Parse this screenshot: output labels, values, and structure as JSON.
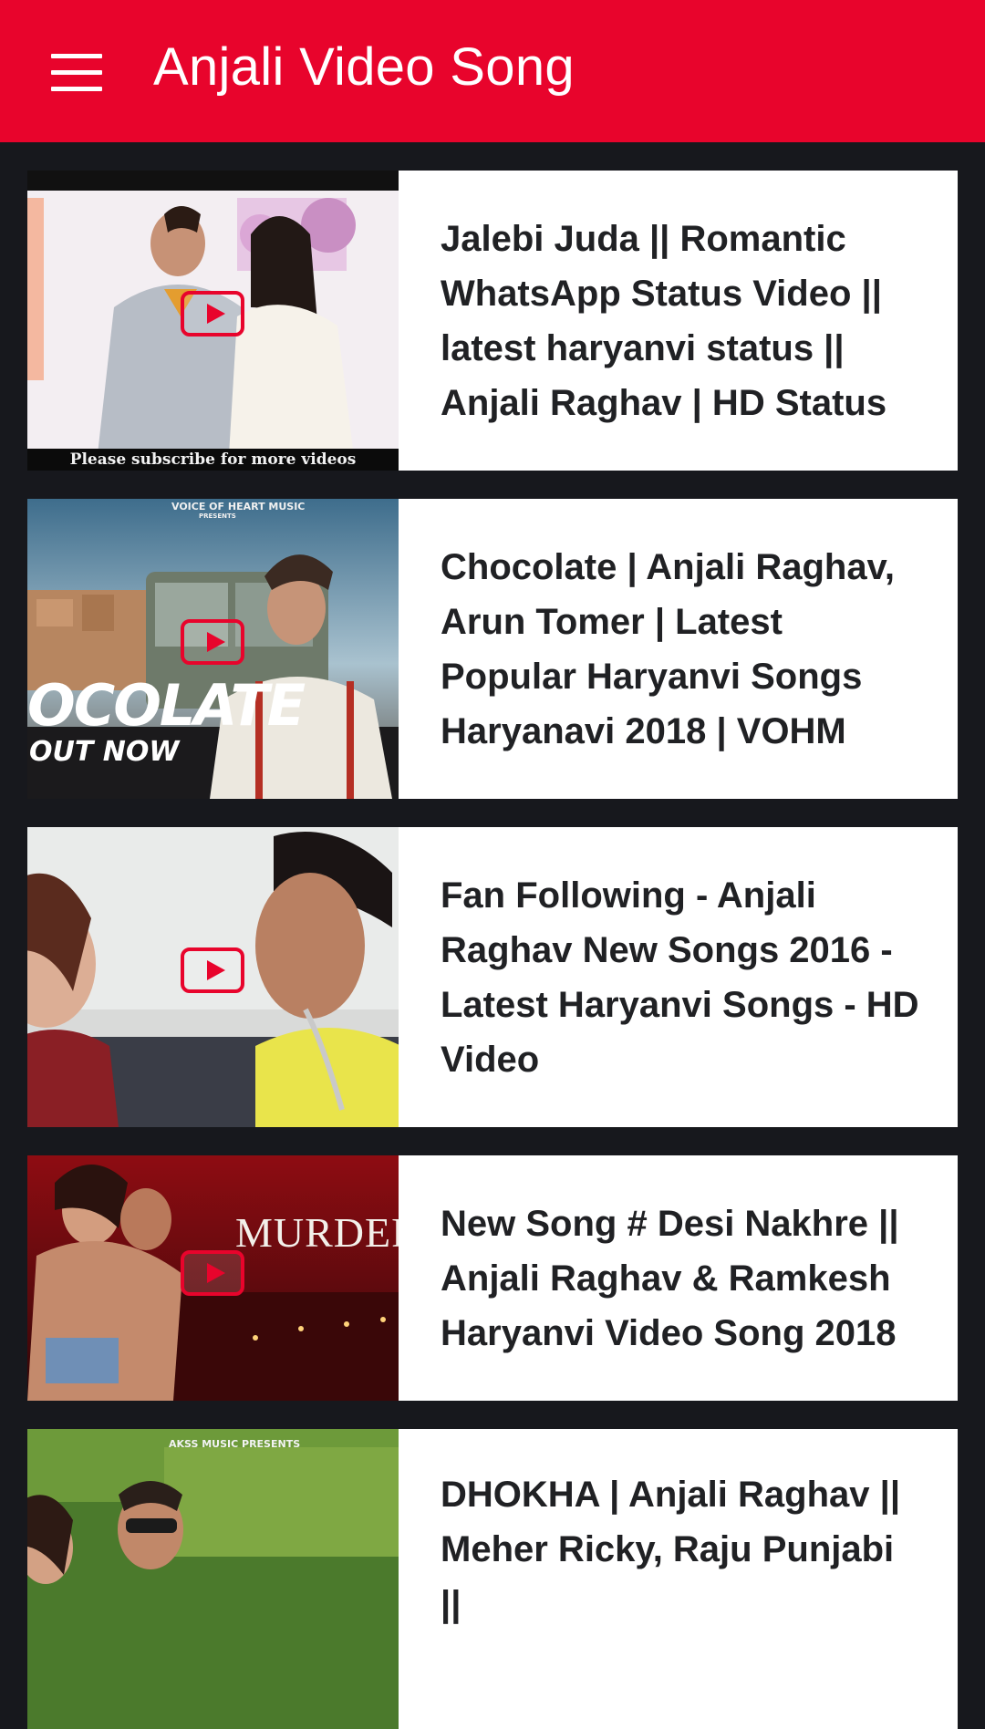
{
  "app": {
    "title": "Anjali Video Song",
    "colors": {
      "primary": "#e8042c",
      "background": "#17181d",
      "card": "#ffffff"
    }
  },
  "videos": [
    {
      "title": "Jalebi Juda || Romantic WhatsApp Status Video || latest haryanvi status || Anjali Raghav | HD Status",
      "thumb_caption": "Please subscribe for more videos"
    },
    {
      "title": "Chocolate | Anjali Raghav, Arun Tomer | Latest Popular Haryanvi Songs Haryanavi 2018 | VOHM",
      "thumb_top": "VOICE OF HEART MUSIC",
      "thumb_sub": "PRESENTS",
      "thumb_big": "OCOLATE",
      "thumb_small": "OUT NOW"
    },
    {
      "title": "Fan Following - Anjali Raghav New Songs 2016 - Latest Haryanvi Songs - HD Video"
    },
    {
      "title": "New Song # Desi Nakhre || Anjali Raghav & Ramkesh Haryanvi Video Song 2018",
      "thumb_big": "MURDER"
    },
    {
      "title": "DHOKHA | Anjali Raghav || Meher Ricky, Raju Punjabi ||",
      "thumb_top": "AKSS MUSIC PRESENTS"
    }
  ],
  "icons": {
    "menu": "hamburger-menu-icon",
    "play": "youtube-play-icon"
  }
}
